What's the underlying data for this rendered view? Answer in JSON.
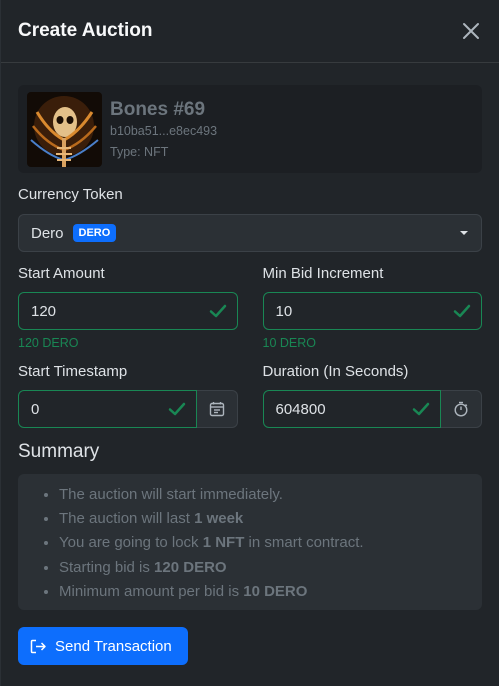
{
  "modal": {
    "title": "Create Auction"
  },
  "nft": {
    "name": "Bones #69",
    "id": "b10ba51...e8ec493",
    "type": "Type: NFT"
  },
  "currency": {
    "label": "Currency Token",
    "value": "Dero",
    "badge": "DERO"
  },
  "start_amount": {
    "label": "Start Amount",
    "value": "120",
    "feedback": "120 DERO"
  },
  "min_bid": {
    "label": "Min Bid Increment",
    "value": "10",
    "feedback": "10 DERO"
  },
  "start_timestamp": {
    "label": "Start Timestamp",
    "value": "0"
  },
  "duration": {
    "label": "Duration (In Seconds)",
    "value": "604800"
  },
  "summary": {
    "title": "Summary",
    "items": [
      {
        "text": "The auction will start immediately.",
        "bold": "",
        "after": ""
      },
      {
        "text": "The auction will last ",
        "bold": "1 week",
        "after": ""
      },
      {
        "text": "You are going to lock ",
        "bold": "1 NFT",
        "after": " in smart contract."
      },
      {
        "text": "Starting bid is ",
        "bold": "120 DERO",
        "after": ""
      },
      {
        "text": "Minimum amount per bid is ",
        "bold": "10 DERO",
        "after": ""
      }
    ]
  },
  "send_button": {
    "label": "Send Transaction"
  },
  "colors": {
    "primary": "#0d6efd",
    "success": "#198754",
    "muted": "#6c757d"
  }
}
